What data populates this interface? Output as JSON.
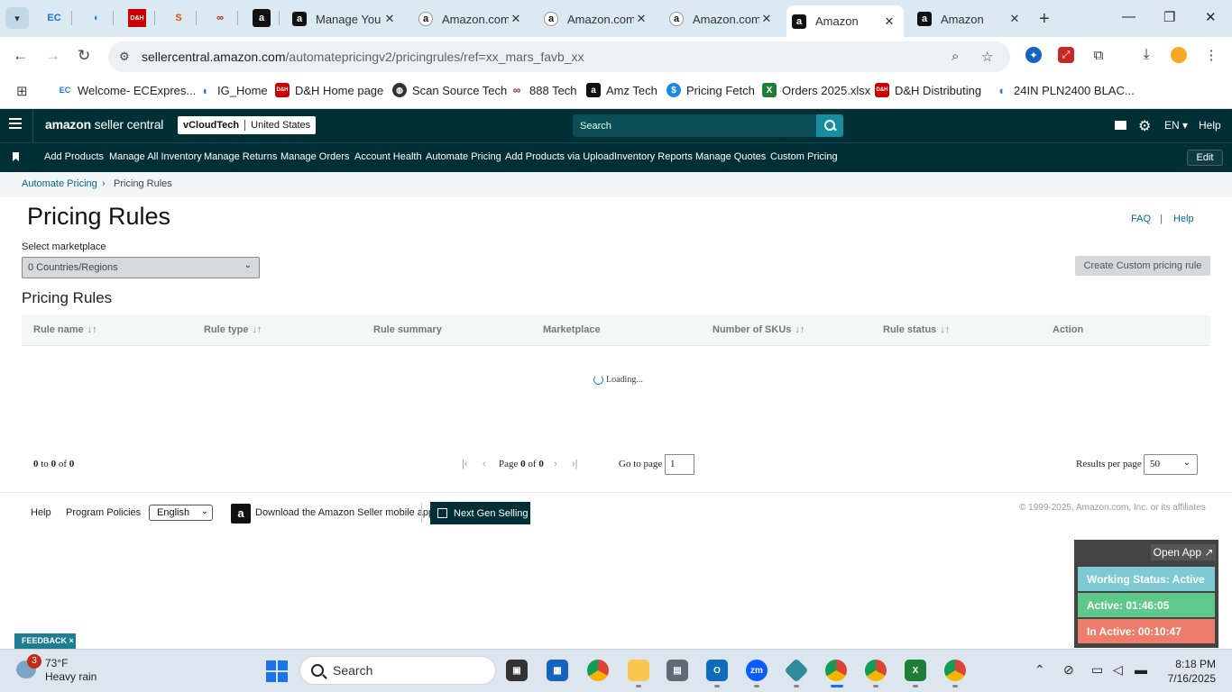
{
  "browser": {
    "tabs": [
      {
        "title": "Manage You",
        "favicon": "amazon-a"
      },
      {
        "title": "Amazon.com",
        "favicon": "amazon-circle"
      },
      {
        "title": "Amazon.com",
        "favicon": "amazon-circle"
      },
      {
        "title": "Amazon.com",
        "favicon": "amazon-circle"
      },
      {
        "title": "Amazon",
        "favicon": "amazon-a",
        "active": true
      },
      {
        "title": "Amazon",
        "favicon": "amazon-a"
      }
    ],
    "url_domain": "sellercentral.amazon.com",
    "url_path": "/automatepricingv2/pricingrules/ref=xx_mars_favb_xx",
    "bookmarks": [
      "Welcome- ECExpres...",
      "IG_Home",
      "D&H Home page",
      "Scan Source Tech",
      "888 Tech",
      "Amz Tech",
      "Pricing Fetch",
      "Orders 2025.xlsx",
      "D&H Distributing",
      "24IN PLN2400 BLAC..."
    ]
  },
  "header": {
    "logo_brand": "amazon",
    "logo_product": "seller central",
    "account_name": "vCloudTech",
    "account_region": "United States",
    "search_placeholder": "Search",
    "language": "EN",
    "help": "Help"
  },
  "nav": {
    "items": [
      "Add Products",
      "Manage All Inventory",
      "Manage Returns",
      "Manage Orders",
      "Account Health",
      "Automate Pricing",
      "Add Products via Upload",
      "Inventory Reports",
      "Manage Quotes",
      "Custom Pricing"
    ],
    "edit": "Edit"
  },
  "breadcrumb": {
    "parent": "Automate Pricing",
    "current": "Pricing Rules"
  },
  "page": {
    "title": "Pricing Rules",
    "faq": "FAQ",
    "sep": "|",
    "help": "Help",
    "marketplace_label": "Select marketplace",
    "marketplace_value": "0 Countries/Regions",
    "create_button": "Create Custom pricing rule",
    "section_title": "Pricing Rules",
    "columns": [
      {
        "label": "Rule name",
        "sortable": true
      },
      {
        "label": "Rule type",
        "sortable": true
      },
      {
        "label": "Rule summary",
        "sortable": false
      },
      {
        "label": "Marketplace",
        "sortable": false
      },
      {
        "label": "Number of SKUs",
        "sortable": true
      },
      {
        "label": "Rule status",
        "sortable": true
      },
      {
        "label": "Action",
        "sortable": false
      }
    ],
    "loading": "Loading..."
  },
  "pagination": {
    "range_start": "0",
    "range_to": "to",
    "range_end": "0",
    "range_of": "of",
    "total": "0",
    "page_label": "Page",
    "page_current": "0",
    "page_of": "of",
    "page_total": "0",
    "goto_label": "Go to page",
    "goto_value": "1",
    "rpp_label": "Results per page",
    "rpp_value": "50"
  },
  "footer": {
    "help": "Help",
    "policies": "Program Policies",
    "language": "English",
    "download_app": "Download the Amazon Seller mobile app",
    "next_gen": "Next Gen Selling",
    "copyright": "© 1999-2025, Amazon.com, Inc. or its affiliates"
  },
  "widget": {
    "open_app": "Open App ↗",
    "working_status": "Working Status: Active",
    "active": "Active: 01:46:05",
    "inactive": "In Active: 00:10:47"
  },
  "feedback": "FEEDBACK ×",
  "taskbar": {
    "weather_badge": "3",
    "temperature": "73°F",
    "condition": "Heavy rain",
    "search": "Search",
    "time": "8:18 PM",
    "date": "7/16/2025"
  },
  "colors": {
    "header_bg": "#002f36",
    "link": "#00688b",
    "status_working": "#7ecad4",
    "status_active": "#5ec98a",
    "status_inactive": "#ee7c6b"
  }
}
